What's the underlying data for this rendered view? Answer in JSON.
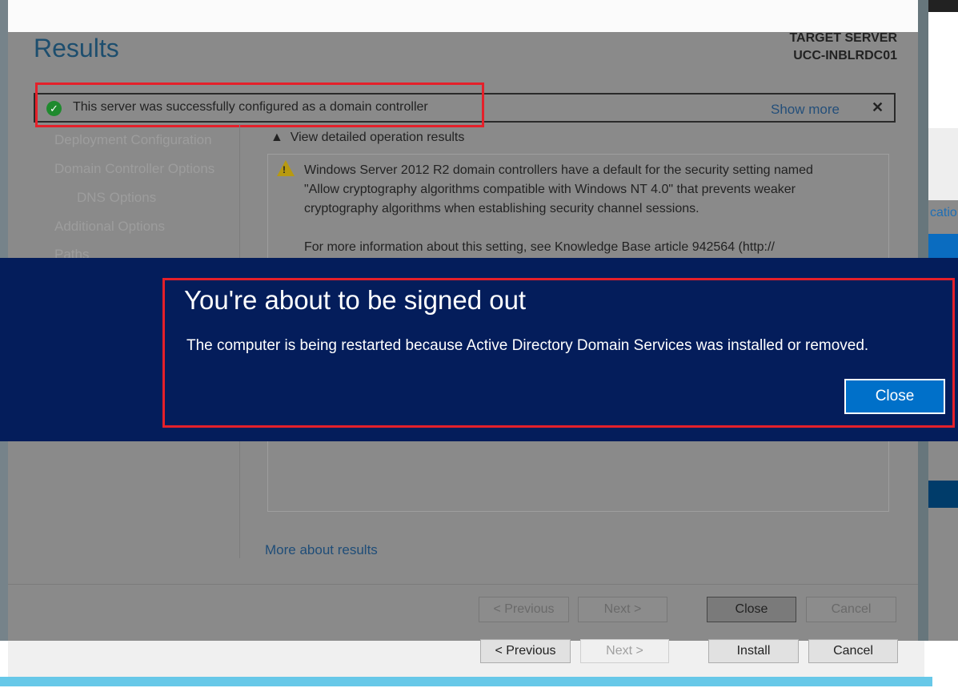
{
  "wizard": {
    "title": "Results",
    "target_label": "TARGET SERVER",
    "target_server": "UCC-INBLRDC01",
    "notification": {
      "text": "This server was successfully configured as a domain controller",
      "show_more": "Show more",
      "close": "✕",
      "icon": "success-check-icon"
    },
    "nav": [
      "Deployment Configuration",
      "Domain Controller Options",
      "DNS Options",
      "Additional Options",
      "Paths"
    ],
    "expand_label": "View detailed operation results",
    "result_lines": [
      "Windows Server 2012 R2 domain controllers have a default for the security setting named",
      "\"Allow cryptography algorithms compatible with Windows NT 4.0\" that prevents weaker",
      "cryptography algorithms when establishing security channel sessions.",
      "For more information about this setting, see Knowledge Base article 942564 (http://"
    ],
    "more_link": "More about results",
    "buttons": {
      "previous": "< Previous",
      "next": "Next >",
      "close": "Close",
      "cancel": "Cancel"
    }
  },
  "underlying": {
    "buttons": {
      "previous": "< Previous",
      "next": "Next >",
      "install": "Install",
      "cancel": "Cancel"
    },
    "right_link_fragment": "catio"
  },
  "signout": {
    "title": "You're about to be signed out",
    "message": "The computer is being restarted because Active Directory Domain Services was installed or removed.",
    "close": "Close",
    "colors": {
      "banner": "#041d5b",
      "button": "#0070c9",
      "highlight": "#e5202a"
    }
  }
}
